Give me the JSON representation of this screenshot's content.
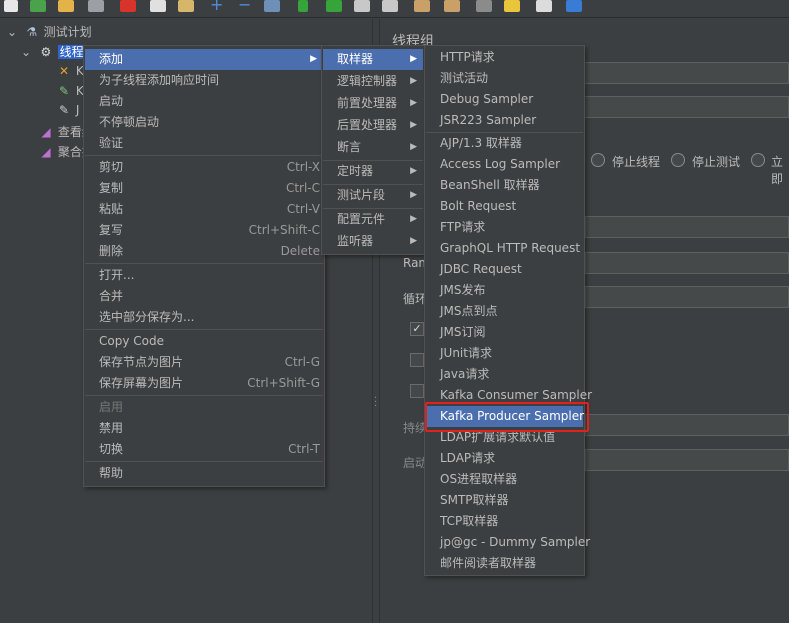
{
  "tree": {
    "test_plan": "测试计划",
    "thread_group": "线程组",
    "child_partial_1": "K",
    "child_partial_2": "K",
    "child_partial_3": "J",
    "view_results": "查看结",
    "aggregate": "聚合报"
  },
  "right_pane": {
    "title": "线程组",
    "radio_stop_thread": "停止线程",
    "radio_stop_test": "停止测试",
    "radio_partial": "立即",
    "ramp_label": "Ram",
    "loop_label": "循环",
    "duration_label": "持续",
    "delay_label": "启动"
  },
  "context_menu": {
    "items": [
      {
        "label": "添加",
        "shortcut": "",
        "submenu": true,
        "active": true,
        "disabled": false
      },
      {
        "label": "为子线程添加响应时间",
        "shortcut": "",
        "submenu": false,
        "active": false,
        "disabled": false
      },
      {
        "label": "启动",
        "shortcut": "",
        "submenu": false,
        "active": false,
        "disabled": false
      },
      {
        "label": "不停顿启动",
        "shortcut": "",
        "submenu": false,
        "active": false,
        "disabled": false
      },
      {
        "label": "验证",
        "shortcut": "",
        "submenu": false,
        "active": false,
        "disabled": false
      },
      {
        "label": "剪切",
        "shortcut": "Ctrl-X",
        "submenu": false,
        "active": false,
        "disabled": false
      },
      {
        "label": "复制",
        "shortcut": "Ctrl-C",
        "submenu": false,
        "active": false,
        "disabled": false
      },
      {
        "label": "粘贴",
        "shortcut": "Ctrl-V",
        "submenu": false,
        "active": false,
        "disabled": false
      },
      {
        "label": "复写",
        "shortcut": "Ctrl+Shift-C",
        "submenu": false,
        "active": false,
        "disabled": false
      },
      {
        "label": "删除",
        "shortcut": "Delete",
        "submenu": false,
        "active": false,
        "disabled": false
      },
      {
        "label": "打开...",
        "shortcut": "",
        "submenu": false,
        "active": false,
        "disabled": false
      },
      {
        "label": "合并",
        "shortcut": "",
        "submenu": false,
        "active": false,
        "disabled": false
      },
      {
        "label": "选中部分保存为...",
        "shortcut": "",
        "submenu": false,
        "active": false,
        "disabled": false
      },
      {
        "label": "Copy Code",
        "shortcut": "",
        "submenu": false,
        "active": false,
        "disabled": false
      },
      {
        "label": "保存节点为图片",
        "shortcut": "Ctrl-G",
        "submenu": false,
        "active": false,
        "disabled": false
      },
      {
        "label": "保存屏幕为图片",
        "shortcut": "Ctrl+Shift-G",
        "submenu": false,
        "active": false,
        "disabled": false
      },
      {
        "label": "启用",
        "shortcut": "",
        "submenu": false,
        "active": false,
        "disabled": true
      },
      {
        "label": "禁用",
        "shortcut": "",
        "submenu": false,
        "active": false,
        "disabled": false
      },
      {
        "label": "切换",
        "shortcut": "Ctrl-T",
        "submenu": false,
        "active": false,
        "disabled": false
      },
      {
        "label": "帮助",
        "shortcut": "",
        "submenu": false,
        "active": false,
        "disabled": false
      }
    ]
  },
  "add_menu": {
    "items": [
      {
        "label": "取样器",
        "active": true
      },
      {
        "label": "逻辑控制器",
        "active": false
      },
      {
        "label": "前置处理器",
        "active": false
      },
      {
        "label": "后置处理器",
        "active": false
      },
      {
        "label": "断言",
        "active": false
      },
      {
        "label": "定时器",
        "active": false
      },
      {
        "label": "测试片段",
        "active": false
      },
      {
        "label": "配置元件",
        "active": false
      },
      {
        "label": "监听器",
        "active": false
      }
    ]
  },
  "sampler_menu": {
    "items": [
      {
        "label": "HTTP请求",
        "active": false
      },
      {
        "label": "测试活动",
        "active": false
      },
      {
        "label": "Debug Sampler",
        "active": false
      },
      {
        "label": "JSR223 Sampler",
        "active": false
      },
      {
        "label": "AJP/1.3 取样器",
        "active": false
      },
      {
        "label": "Access Log Sampler",
        "active": false
      },
      {
        "label": "BeanShell 取样器",
        "active": false
      },
      {
        "label": "Bolt Request",
        "active": false
      },
      {
        "label": "FTP请求",
        "active": false
      },
      {
        "label": "GraphQL HTTP Request",
        "active": false
      },
      {
        "label": "JDBC Request",
        "active": false
      },
      {
        "label": "JMS发布",
        "active": false
      },
      {
        "label": "JMS点到点",
        "active": false
      },
      {
        "label": "JMS订阅",
        "active": false
      },
      {
        "label": "JUnit请求",
        "active": false
      },
      {
        "label": "Java请求",
        "active": false
      },
      {
        "label": "Kafka Consumer Sampler",
        "active": false
      },
      {
        "label": "Kafka Producer Sampler",
        "active": true
      },
      {
        "label": "LDAP扩展请求默认值",
        "active": false
      },
      {
        "label": "LDAP请求",
        "active": false
      },
      {
        "label": "OS进程取样器",
        "active": false
      },
      {
        "label": "SMTP取样器",
        "active": false
      },
      {
        "label": "TCP取样器",
        "active": false
      },
      {
        "label": "jp@gc - Dummy Sampler",
        "active": false
      },
      {
        "label": "邮件阅读者取样器",
        "active": false
      }
    ]
  },
  "colors": {
    "background": "#3c3f41",
    "menu_active": "#4b6eaf",
    "highlight_border": "#e0211c",
    "tree_selected": "#2f65ca"
  },
  "icons": [
    "new-icon",
    "open-icon",
    "save-icon",
    "cut-icon",
    "copy-icon",
    "paste-icon",
    "add-icon",
    "remove-icon",
    "browse-icon",
    "start-icon",
    "start-no-pause-icon",
    "stop-icon",
    "shutdown-icon",
    "clear-icon",
    "clear-all-icon",
    "search-icon",
    "reset-search-icon",
    "function-helper-icon",
    "help-icon"
  ]
}
